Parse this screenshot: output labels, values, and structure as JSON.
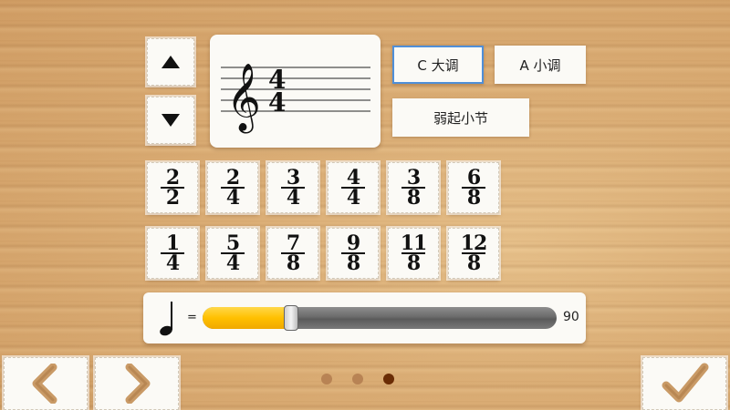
{
  "pitch_controls": {
    "up_icon": "triangle-up-icon",
    "down_icon": "triangle-down-icon"
  },
  "staff_preview": {
    "time_signature": {
      "top": "4",
      "bottom": "4"
    },
    "clef": "treble-clef"
  },
  "key_options": [
    {
      "label": "C 大调",
      "selected": true
    },
    {
      "label": "A 小调",
      "selected": false
    }
  ],
  "pickup_button": {
    "label": "弱起小节"
  },
  "time_signatures": [
    {
      "top": "2",
      "bottom": "2"
    },
    {
      "top": "2",
      "bottom": "4"
    },
    {
      "top": "3",
      "bottom": "4"
    },
    {
      "top": "4",
      "bottom": "4"
    },
    {
      "top": "3",
      "bottom": "8"
    },
    {
      "top": "6",
      "bottom": "8"
    },
    {
      "top": "1",
      "bottom": "4"
    },
    {
      "top": "5",
      "bottom": "4"
    },
    {
      "top": "7",
      "bottom": "8"
    },
    {
      "top": "9",
      "bottom": "8"
    },
    {
      "top": "11",
      "bottom": "8"
    },
    {
      "top": "12",
      "bottom": "8"
    }
  ],
  "tempo": {
    "note_icon": "quarter-note-icon",
    "equals": "=",
    "value": "90",
    "min": 20,
    "max": 300
  },
  "pager": {
    "count": 3,
    "active_index": 2
  },
  "colors": {
    "accent": "#4f8fd8",
    "slider_fill": "#ffc000",
    "dot_active": "#6a2c05",
    "dot_inactive": "#b88354"
  }
}
